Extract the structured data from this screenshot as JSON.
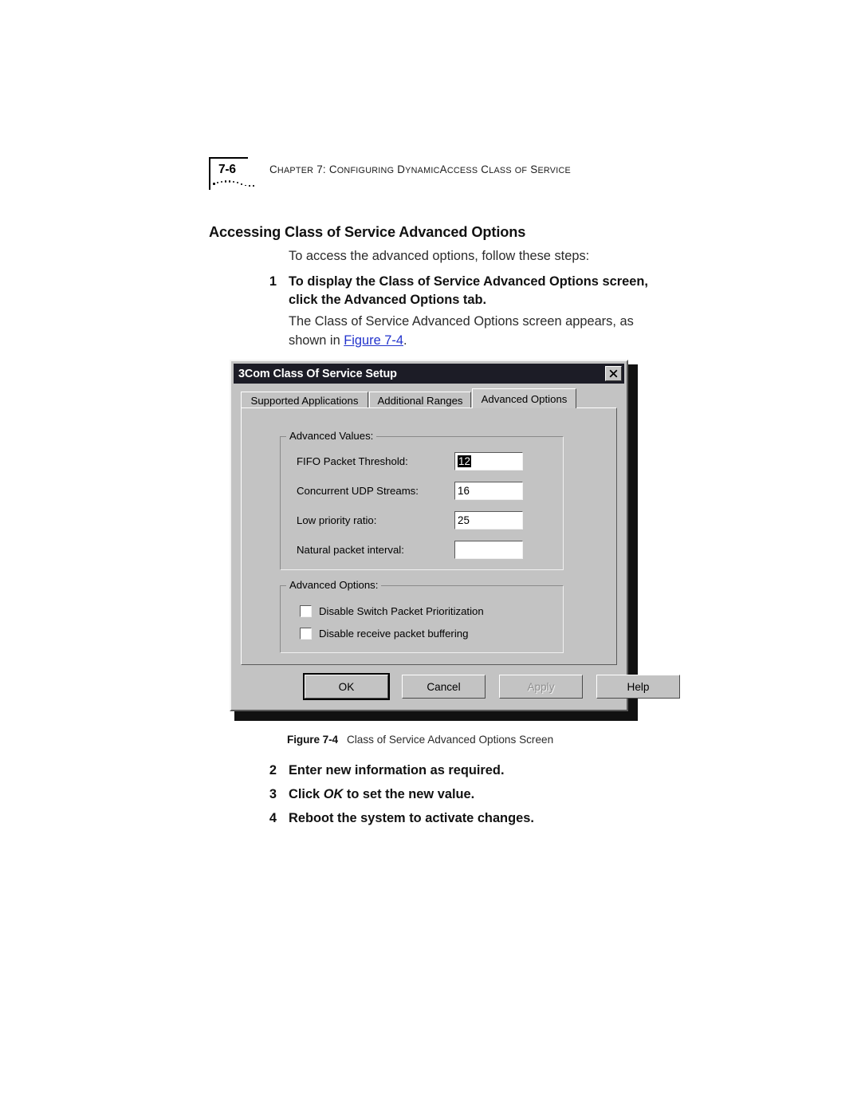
{
  "page": {
    "folio": "7-6",
    "running_head_parts": [
      {
        "text": "C",
        "small_caps": false
      },
      {
        "text": "HAPTER",
        "small_caps": true
      },
      {
        "text": " 7: C",
        "small_caps": false
      },
      {
        "text": "ONFIGURING",
        "small_caps": true
      },
      {
        "text": " D",
        "small_caps": false
      },
      {
        "text": "YNAMIC",
        "small_caps": true
      },
      {
        "text": "A",
        "small_caps": false
      },
      {
        "text": "CCESS",
        "small_caps": true
      },
      {
        "text": " C",
        "small_caps": false
      },
      {
        "text": "LASS",
        "small_caps": true
      },
      {
        "text": " ",
        "small_caps": false
      },
      {
        "text": "OF",
        "small_caps": true
      },
      {
        "text": " S",
        "small_caps": false
      },
      {
        "text": "ERVICE",
        "small_caps": true
      }
    ],
    "running_head_plain": "CHAPTER 7: CONFIGURING DYNAMICACCESS CLASS OF SERVICE"
  },
  "content": {
    "heading": "Accessing Class of Service Advanced Options",
    "intro_paragraph": "To access the advanced options, follow these steps:",
    "step1": {
      "number": "1",
      "text": "To display the Class of Service Advanced Options screen, click the Advanced Options tab."
    },
    "body_paragraph_prefix": "The Class of Service Advanced Options screen appears, as shown in ",
    "body_paragraph_link": "Figure 7-4",
    "body_paragraph_suffix": ".",
    "step2": {
      "number": "2",
      "text": "Enter new information as required."
    },
    "step3": {
      "number": "3",
      "prefix": "Click ",
      "emphasis": "OK",
      "suffix": " to set the new value."
    },
    "step4": {
      "number": "4",
      "text": "Reboot the system to activate changes."
    },
    "figure_caption": {
      "label": "Figure 7-4",
      "text": "Class of Service Advanced Options Screen"
    }
  },
  "dialog": {
    "title": "3Com Class Of Service Setup",
    "close_button": "close-icon",
    "tabs": [
      {
        "label": "Supported Applications",
        "active": false
      },
      {
        "label": "Additional Ranges",
        "active": false
      },
      {
        "label": "Advanced Options",
        "active": true
      }
    ],
    "advanced_values": {
      "group_title": "Advanced Values:",
      "fields": [
        {
          "label": "FIFO Packet Threshold:",
          "value": "12",
          "selected": true
        },
        {
          "label": "Concurrent UDP Streams:",
          "value": "16",
          "selected": false
        },
        {
          "label": "Low priority ratio:",
          "value": "25",
          "selected": false
        },
        {
          "label": "Natural packet interval:",
          "value": "",
          "selected": false
        }
      ]
    },
    "advanced_options": {
      "group_title": "Advanced Options:",
      "checkboxes": [
        {
          "label": "Disable Switch Packet Prioritization",
          "checked": false
        },
        {
          "label": "Disable receive packet buffering",
          "checked": false
        }
      ]
    },
    "buttons": [
      {
        "label": "OK",
        "default": true,
        "disabled": false
      },
      {
        "label": "Cancel",
        "default": false,
        "disabled": false
      },
      {
        "label": "Apply",
        "default": false,
        "disabled": true
      },
      {
        "label": "Help",
        "default": false,
        "disabled": false
      }
    ]
  },
  "colors": {
    "page_background": "#ffffff",
    "dialog_face": "#c3c3c3",
    "titlebar": "#1c1c26",
    "titlebar_text": "#ffffff",
    "link": "#2233cc",
    "selection": "#000000",
    "disabled_text": "#8f8f8f"
  }
}
